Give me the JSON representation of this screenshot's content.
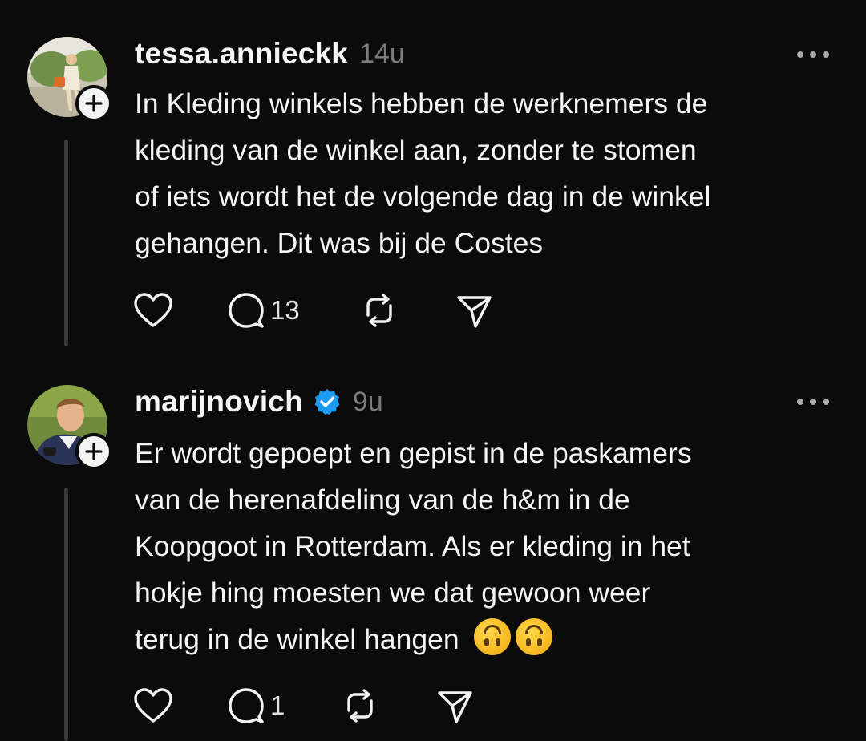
{
  "posts": [
    {
      "username": "tessa.annieckk",
      "time": "14u",
      "verified": false,
      "lines": [
        "In Kleding winkels hebben de werknemers de",
        "kleding van de winkel aan, zonder te stomen",
        "of iets wordt het de volgende dag in de winkel",
        "gehangen. Dit was bij de Costes"
      ],
      "replies": "13"
    },
    {
      "username": "marijnovich",
      "time": "9u",
      "verified": true,
      "lines": [
        "Er wordt gepoept en gepist in de paskamers",
        "van de herenafdeling van de h&m in de",
        "Koopgoot in Rotterdam. Als er kleding in het",
        "hokje hing moesten we dat gewoon weer",
        "terug in de winkel hangen"
      ],
      "emojis": [
        "upside-down-face-emoji",
        "upside-down-face-emoji"
      ],
      "replies": "1"
    }
  ],
  "colors": {
    "background": "#0b0b0b",
    "text": "#f5f5f5",
    "muted": "#7c7c7c",
    "verified": "#1d9bf0",
    "thread_line": "#3a3a3a"
  },
  "icons": [
    "heart-icon",
    "comment-icon",
    "repost-icon",
    "share-icon",
    "more-icon",
    "plus-icon",
    "verified-icon"
  ]
}
